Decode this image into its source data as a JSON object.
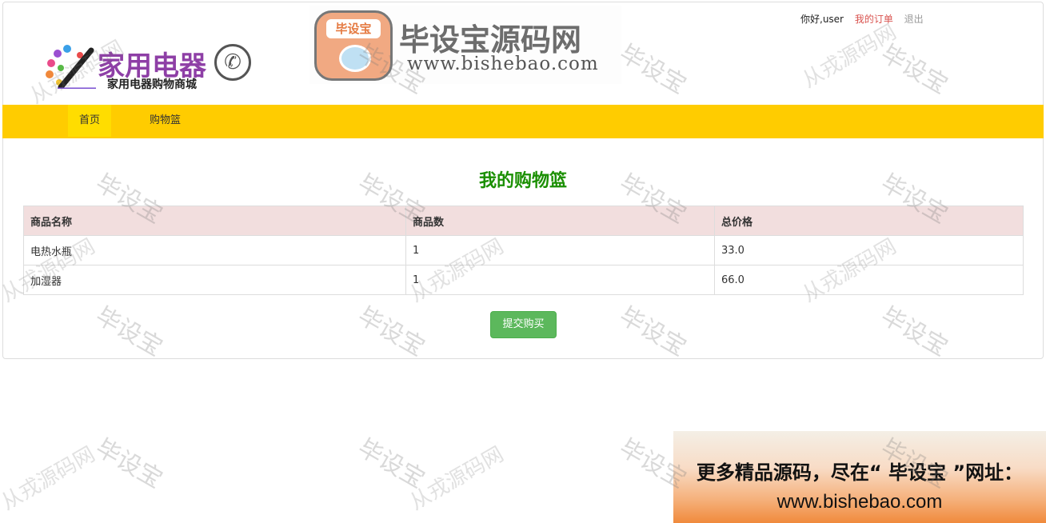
{
  "header": {
    "logo_title": "家用电器",
    "logo_subtitle": "家用电器购物商城",
    "banner_badge": "毕设宝",
    "banner_title": "毕设宝源码网",
    "banner_url": "www.bishebao.com"
  },
  "userbar": {
    "greeting": "你好,user",
    "orders": "我的订单",
    "logout": "退出"
  },
  "nav": {
    "home": "首页",
    "cart": "购物篮"
  },
  "main": {
    "title": "我的购物篮",
    "columns": [
      "商品名称",
      "商品数",
      "总价格"
    ],
    "rows": [
      {
        "name": "电热水瓶",
        "qty": "1",
        "total": "33.0"
      },
      {
        "name": "加湿器",
        "qty": "1",
        "total": "66.0"
      }
    ],
    "submit": "提交购买"
  },
  "ad": {
    "line1": "更多精品源码，尽在“ 毕设宝 ”网址：",
    "line2": "www.bishebao.com"
  },
  "watermarks": {
    "brand": "毕设宝",
    "site": "从戎源码网"
  }
}
